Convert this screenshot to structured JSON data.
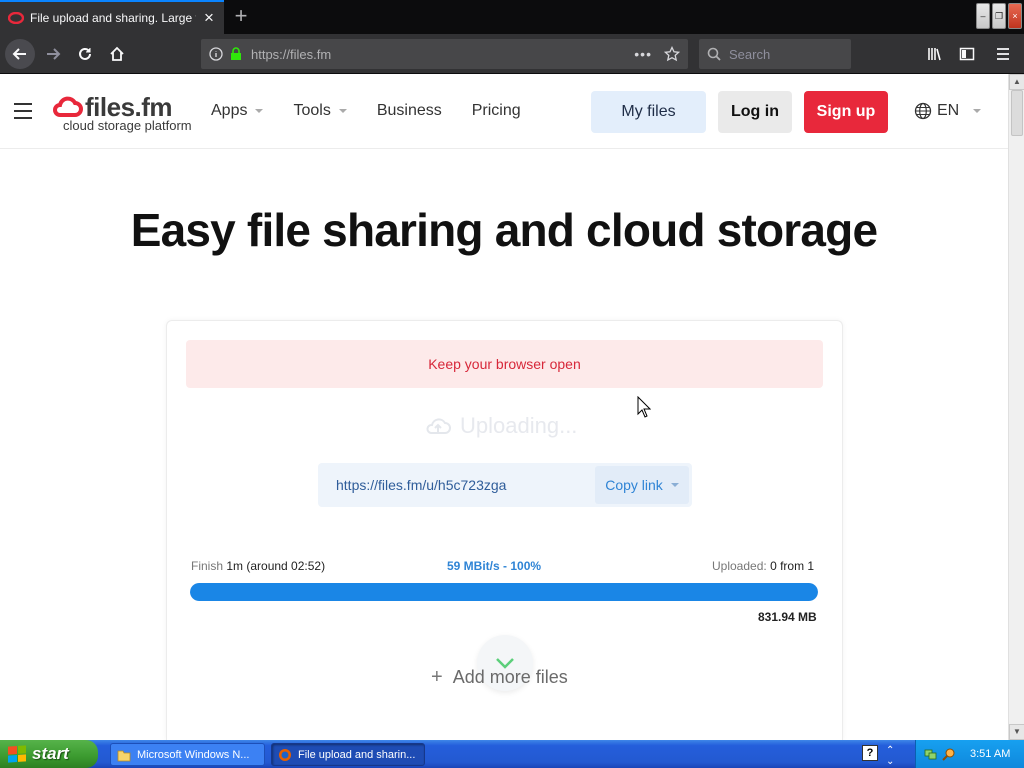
{
  "browser": {
    "tab_title": "File upload and sharing. Large file",
    "url": "https://files.fm",
    "search_placeholder": "Search"
  },
  "header": {
    "logo_name": "files.fm",
    "logo_tagline": "cloud storage platform",
    "nav": [
      {
        "label": "Apps",
        "has_dropdown": true
      },
      {
        "label": "Tools",
        "has_dropdown": true
      },
      {
        "label": "Business",
        "has_dropdown": false
      },
      {
        "label": "Pricing",
        "has_dropdown": false
      }
    ],
    "my_files": "My files",
    "login": "Log in",
    "signup": "Sign up",
    "language": "EN"
  },
  "main": {
    "headline": "Easy file sharing and cloud storage",
    "alert": "Keep your browser open",
    "status": "Uploading...",
    "share_link": "https://files.fm/u/h5c723zga",
    "copy_link": "Copy link",
    "finish_label": "Finish",
    "finish_value": "1m (around 02:52)",
    "speed": "59 MBit/s - 100%",
    "uploaded_label": "Uploaded:",
    "uploaded_value": "0 from 1",
    "progress_fraction": 1.0,
    "size": "831.94 MB",
    "add_more": "Add more files"
  },
  "taskbar": {
    "start": "start",
    "tasks": [
      {
        "label": "Microsoft Windows N..."
      },
      {
        "label": "File upload and sharin..."
      }
    ],
    "time": "3:51 AM"
  },
  "colors": {
    "accent_blue": "#1a86e6",
    "signup_red": "#e8283b",
    "alert_text": "#d7283a"
  }
}
